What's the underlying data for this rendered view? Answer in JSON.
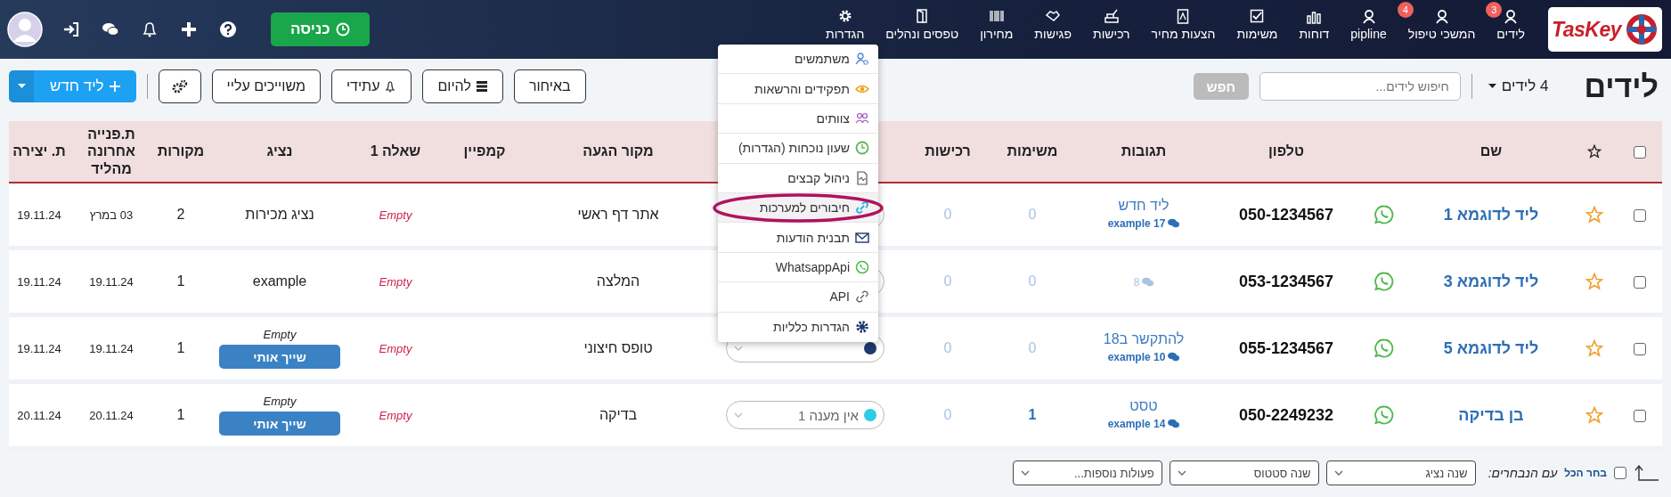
{
  "nav": {
    "logo": "TasKey",
    "items": [
      {
        "label": "לידים",
        "badge": "3"
      },
      {
        "label": "המשכי טיפול",
        "badge": "4"
      },
      {
        "label": "pipline"
      },
      {
        "label": "דוחות"
      },
      {
        "label": "משימות"
      },
      {
        "label": "הצעות מחיר"
      },
      {
        "label": "רכישות"
      },
      {
        "label": "פגישות"
      },
      {
        "label": "מחירון"
      },
      {
        "label": "טפסים ונהלים"
      },
      {
        "label": "הגדרות",
        "expanded": true
      }
    ],
    "clock_in_button": "כניסה"
  },
  "toolbar": {
    "title": "לידים",
    "count": "4 לידים",
    "search": {
      "placeholder": "חיפוש לידים..."
    },
    "search_button": {
      "label": "חפש",
      "disabled": true
    },
    "filters": [
      {
        "label": "באיחור"
      },
      {
        "label": "להיום"
      },
      {
        "label": "עתידי"
      },
      {
        "label": "משוייכים עליי"
      }
    ],
    "new_button": "ליד חדש"
  },
  "settings_menu": {
    "items": [
      {
        "label": "משתמשים",
        "selected": false
      },
      {
        "label": "תפקידים והרשאות",
        "selected": false
      },
      {
        "label": "צוותים",
        "selected": false
      },
      {
        "label": "שעון נוכחות (הגדרות)",
        "selected": false
      },
      {
        "label": "ניהול קבצים",
        "selected": false
      },
      {
        "label": "חיבורים למערכות",
        "selected": true,
        "circled": true
      },
      {
        "label": "תבנית הודעות",
        "selected": false
      },
      {
        "label": "WhatsappApi",
        "selected": false
      },
      {
        "label": "API",
        "selected": false
      },
      {
        "label": "הגדרות כלליות",
        "selected": false
      }
    ]
  },
  "table": {
    "header_checked": false,
    "columns": [
      "שם",
      "טלפון",
      "תגובות",
      "משימות",
      "רכישות",
      "מקור הגעה",
      "קמפיין",
      "שאלה 1",
      "נציג",
      "מקורות",
      "ת.פנייה אחרונה מהליד",
      "ת. יצירה"
    ],
    "rows": [
      {
        "checked": false,
        "starred": false,
        "name": "ליד לדוגמא 1",
        "phone": "050-1234567",
        "reply": {
          "text": "ליד חדש",
          "count": "17",
          "author": "example",
          "muted": false
        },
        "tasks": {
          "value": "0",
          "emphasis": false
        },
        "purchases": "0",
        "status": {},
        "source": "אתר דף ראשי",
        "question_1": "Empty",
        "rep": {
          "name": "נציג מכירות"
        },
        "sources": "2",
        "last_contact": "03 במרץ",
        "created": "19.11.24"
      },
      {
        "checked": false,
        "starred": false,
        "name": "ליד לדוגמא 3",
        "phone": "053-1234567",
        "reply": {
          "count": "8",
          "muted": true
        },
        "tasks": {
          "value": "0",
          "emphasis": false
        },
        "purchases": "0",
        "status": {},
        "source": "המלצה",
        "question_1": "Empty",
        "rep": {
          "name": "example"
        },
        "sources": "1",
        "last_contact": "19.11.24",
        "created": "19.11.24"
      },
      {
        "checked": false,
        "starred": false,
        "name": "ליד לדוגמא 5",
        "phone": "055-1234567",
        "reply": {
          "text": "להתקשר ב18",
          "count": "10",
          "author": "example",
          "muted": false
        },
        "tasks": {
          "value": "0",
          "emphasis": false
        },
        "purchases": "0",
        "status": {
          "color": "#1e3a6e"
        },
        "source": "טופס חיצוני",
        "question_1": "Empty",
        "rep": {
          "name": "Empty",
          "assign_button": "שייך אותי"
        },
        "sources": "1",
        "last_contact": "19.11.24",
        "created": "19.11.24"
      },
      {
        "checked": false,
        "starred": false,
        "name": "בן בדיקה",
        "phone": "050-2249232",
        "reply": {
          "text": "טסט",
          "count": "14",
          "author": "example",
          "muted": false
        },
        "tasks": {
          "value": "1",
          "emphasis": true
        },
        "purchases": "0",
        "status": {
          "label": "אין מענה 1",
          "color": "#2ecbe6"
        },
        "source": "בדיקה",
        "question_1": "Empty",
        "rep": {
          "name": "Empty",
          "assign_button": "שייך אותי"
        },
        "sources": "1",
        "last_contact": "20.11.24",
        "created": "20.11.24"
      }
    ]
  },
  "bulk_bar": {
    "select_all": {
      "label": "בחר הכל",
      "checked": false
    },
    "with_selected": "עם הנבחרים:",
    "selects": [
      {
        "value": "שנה נציג"
      },
      {
        "value": "שנה סטטוס"
      },
      {
        "value": "פעולות נוספות..."
      }
    ]
  }
}
